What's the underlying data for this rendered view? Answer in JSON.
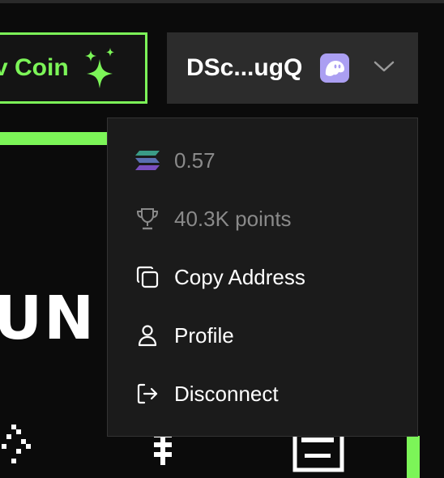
{
  "header": {
    "create_button_label": "v Coin",
    "wallet_address": "DSc...ugQ",
    "wallet_provider_icon": "phantom-ghost-icon",
    "dropdown_icon": "chevron-down-icon"
  },
  "background": {
    "banner_text": "UN I"
  },
  "dropdown": {
    "balance": {
      "icon": "solana-icon",
      "label": "0.57"
    },
    "points": {
      "icon": "trophy-icon",
      "label": "40.3K points"
    },
    "items": [
      {
        "icon": "copy-icon",
        "label": "Copy Address"
      },
      {
        "icon": "user-icon",
        "label": "Profile"
      },
      {
        "icon": "logout-icon",
        "label": "Disconnect"
      }
    ]
  },
  "colors": {
    "accent_green": "#7cf558",
    "phantom_purple": "#ab9ff2",
    "dropdown_bg": "#1b1b1b",
    "wallet_btn_bg": "#2c2c2c",
    "muted_text": "#8a8a8a"
  }
}
